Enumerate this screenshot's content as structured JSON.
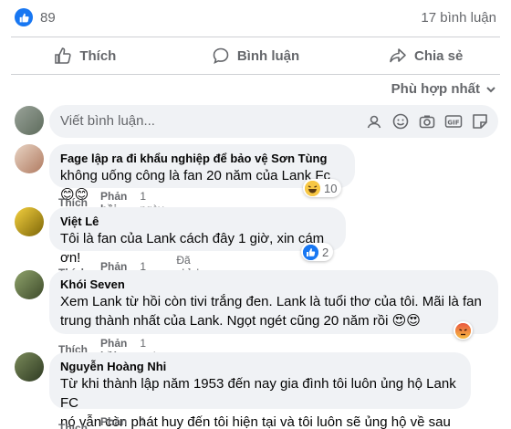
{
  "stats": {
    "like_count": "89",
    "comment_count": "17 bình luận"
  },
  "actions": {
    "like": "Thích",
    "comment": "Bình luận",
    "share": "Chia sẻ"
  },
  "sort": {
    "label": "Phù hợp nhất"
  },
  "composer": {
    "placeholder": "Viết bình luận..."
  },
  "comments": [
    {
      "name": "Fage lập ra đi khẩu nghiệp để bảo vệ Sơn Tùng",
      "text": "không uống công là fan 20 năm của Lank Fc 😊😊",
      "like": "Thích",
      "reply": "Phản hồi",
      "time": "1 ngày",
      "reaction_count": "10"
    },
    {
      "name": "Việt Lê",
      "text": "Tôi là fan của Lank cách đây 1 giờ, xin cám ơn!",
      "like": "Thích",
      "reply": "Phản hồi",
      "time": "1 ngày",
      "edited": "Đã chỉnh sửa",
      "reaction_count": "2"
    },
    {
      "name": "Khói Seven",
      "text1": "Xem Lank từ hồi còn tivi trắng đen. Lank là tuổi thơ của tôi. Mãi là fan",
      "text2": "trung thành nhất của Lank. Ngọt ngét cũng 20 năm rồi 😍😍",
      "like": "Thích",
      "reply": "Phản hồi",
      "time": "1 ngày"
    },
    {
      "name": "Nguyễn Hoàng Nhi",
      "text1": "Từ khi thành lập năm 1953 đến nay gia đình tôi luôn ủng hộ Lank FC",
      "text2": "nó vẫn còn phát huy đến tôi hiện tại và tôi luôn sẽ ủng hộ về sau",
      "like": "Thích",
      "reply": "Phản hồi",
      "time": "1 ngày"
    }
  ],
  "colors": {
    "accent": "#1877f2",
    "bubble": "#f0f2f5",
    "muted": "#65676b"
  }
}
